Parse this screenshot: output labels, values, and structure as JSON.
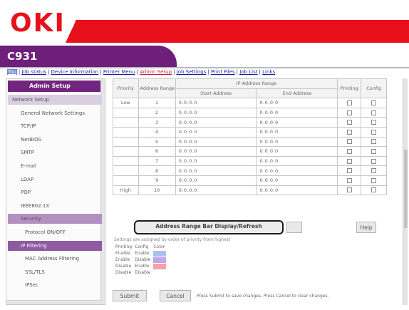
{
  "brand": {
    "logo": "OKI",
    "model": "C931"
  },
  "nav": [
    {
      "label": "Top",
      "state": "hi"
    },
    {
      "label": "Job status",
      "state": "normal"
    },
    {
      "label": "Device Information",
      "state": "normal"
    },
    {
      "label": "Printer Menu",
      "state": "normal"
    },
    {
      "label": "Admin Setup",
      "state": "current"
    },
    {
      "label": "Job Settings",
      "state": "normal"
    },
    {
      "label": "Print Files",
      "state": "normal"
    },
    {
      "label": "Job List",
      "state": "normal"
    },
    {
      "label": "Links",
      "state": "normal"
    }
  ],
  "sidebar": {
    "title": "Admin Setup",
    "items": [
      {
        "label": "Network Setup",
        "style": "grp"
      },
      {
        "label": "General Network Settings",
        "style": "item"
      },
      {
        "label": "TCP/IP",
        "style": "item"
      },
      {
        "label": "NetBIOS",
        "style": "item"
      },
      {
        "label": "SMTP",
        "style": "item"
      },
      {
        "label": "E-mail",
        "style": "item"
      },
      {
        "label": "LDAP",
        "style": "item"
      },
      {
        "label": "POP",
        "style": "item"
      },
      {
        "label": "IEEE802.1X",
        "style": "item"
      },
      {
        "label": "Security",
        "style": "sel"
      },
      {
        "label": "Protocol ON/OFF",
        "style": "sub"
      },
      {
        "label": "IP Filtering",
        "style": "hl"
      },
      {
        "label": "MAC Address Filtering",
        "style": "sub"
      },
      {
        "label": "SSL/TLS",
        "style": "sub"
      },
      {
        "label": "IPSec",
        "style": "sub"
      }
    ]
  },
  "table": {
    "headers": {
      "priority": "Priority",
      "range_no": "Address Range No.",
      "ip_range": "IP Address Range",
      "start": "Start Address",
      "end": "End Address",
      "printing": "Printing",
      "config": "Config"
    },
    "priority_low": "Low",
    "priority_high": "High",
    "rows": [
      {
        "no": "1",
        "start": "0.0.0.0",
        "end": "0.0.0.0"
      },
      {
        "no": "2",
        "start": "0.0.0.0",
        "end": "0.0.0.0"
      },
      {
        "no": "3",
        "start": "0.0.0.0",
        "end": "0.0.0.0"
      },
      {
        "no": "4",
        "start": "0.0.0.0",
        "end": "0.0.0.0"
      },
      {
        "no": "5",
        "start": "0.0.0.0",
        "end": "0.0.0.0"
      },
      {
        "no": "6",
        "start": "0.0.0.0",
        "end": "0.0.0.0"
      },
      {
        "no": "7",
        "start": "0.0.0.0",
        "end": "0.0.0.0"
      },
      {
        "no": "8",
        "start": "0.0.0.0",
        "end": "0.0.0.0"
      },
      {
        "no": "9",
        "start": "0.0.0.0",
        "end": "0.0.0.0"
      },
      {
        "no": "10",
        "start": "0.0.0.0",
        "end": "0.0.0.0"
      }
    ]
  },
  "buttons": {
    "address_range": "Address Range Bar Display/Refresh",
    "help": "Help",
    "submit": "Submit",
    "cancel": "Cancel"
  },
  "settings_note": "Settings are assigned by order of priority from highest",
  "legend": {
    "header": [
      "Printing",
      "Config",
      "Color"
    ],
    "rows": [
      {
        "printing": "Enable",
        "config": "Enable",
        "color": "#a7c3ea"
      },
      {
        "printing": "Enable",
        "config": "Disable",
        "color": "#c3a6e3"
      },
      {
        "printing": "Disable",
        "config": "Enable",
        "color": "#f3a2aa"
      },
      {
        "printing": "Disable",
        "config": "Disable",
        "color": ""
      }
    ]
  },
  "bottom_note": "Press Submit to save changes. Press Cancel to clear changes."
}
